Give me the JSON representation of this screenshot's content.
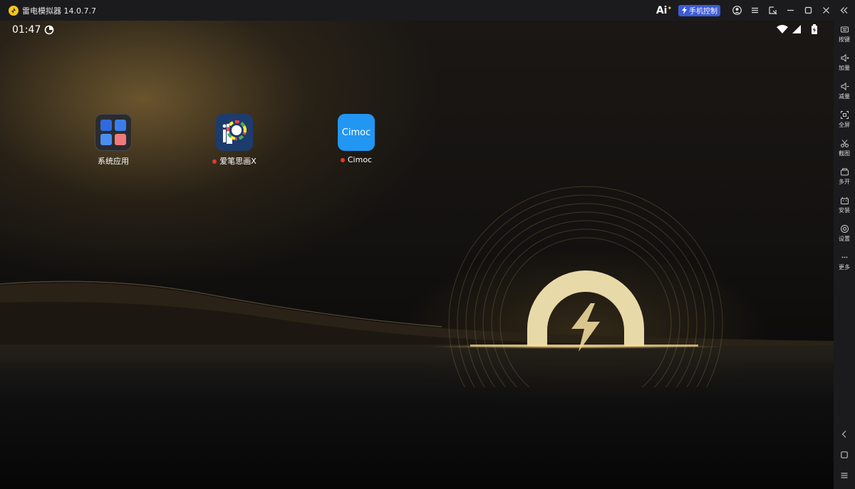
{
  "window": {
    "title": "雷电模拟器 14.0.7.7",
    "ai_label": "Ai",
    "phone_control_label": "手机控制"
  },
  "statusbar": {
    "time": "01:47"
  },
  "apps": [
    {
      "label": "系统应用",
      "icon": "folder-icon",
      "new_dot": false
    },
    {
      "label": "爱笔思画X",
      "icon": "ibispaint-icon",
      "new_dot": true
    },
    {
      "label": "Cimoc",
      "icon": "cimoc-icon",
      "icon_text": "Cimoc",
      "new_dot": true
    }
  ],
  "sidebar": {
    "items": [
      {
        "label": "按键",
        "icon": "keyboard-icon"
      },
      {
        "label": "加量",
        "icon": "volume-up-icon"
      },
      {
        "label": "减量",
        "icon": "volume-down-icon"
      },
      {
        "label": "全屏",
        "icon": "fullscreen-icon"
      },
      {
        "label": "截图",
        "icon": "screenshot-icon"
      },
      {
        "label": "多开",
        "icon": "multi-instance-icon"
      },
      {
        "label": "安装",
        "icon": "install-icon"
      },
      {
        "label": "设置",
        "icon": "settings-icon"
      },
      {
        "label": "更多",
        "icon": "more-icon"
      }
    ]
  },
  "colors": {
    "accent": "#3d5bd6",
    "logo_gold": "#e8d49a",
    "cimoc_blue": "#2196f3",
    "new_dot": "#e03a2f"
  }
}
